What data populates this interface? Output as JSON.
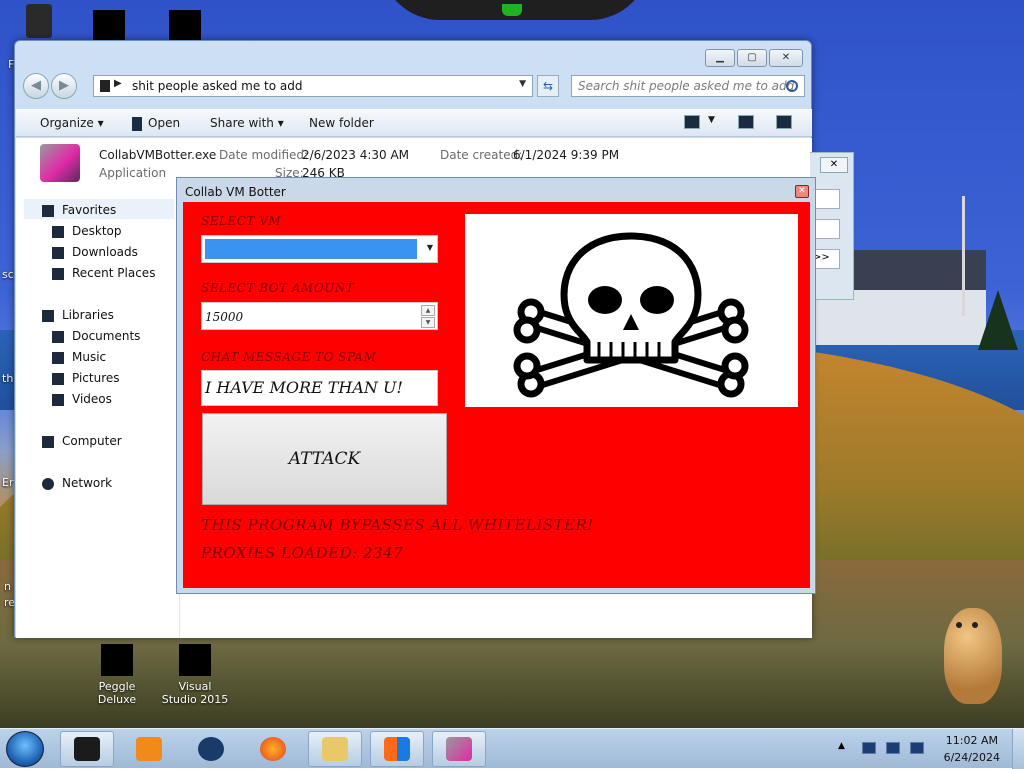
{
  "desktop": {
    "icons_bottom": [
      {
        "label": "Peggle Deluxe"
      },
      {
        "label": "Visual Studio 2015"
      }
    ],
    "edge_fragments": [
      "F",
      "sc",
      "th",
      "Er",
      "n",
      "re"
    ]
  },
  "explorer": {
    "address": "shit people asked me to add",
    "search_placeholder": "Search shit people asked me to add",
    "toolbar": {
      "organize": "Organize",
      "open": "Open",
      "share_with": "Share with",
      "new_folder": "New folder"
    },
    "details": {
      "file_name": "CollabVMBotter.exe",
      "file_type": "Application",
      "modified_label": "Date modified:",
      "modified_value": "2/6/2023 4:30 AM",
      "created_label": "Date created:",
      "created_value": "6/1/2024 9:39 PM",
      "size_label": "Size:",
      "size_value": "246 KB"
    },
    "nav": {
      "favorites": "Favorites",
      "desktop": "Desktop",
      "downloads": "Downloads",
      "recent_places": "Recent Places",
      "libraries": "Libraries",
      "documents": "Documents",
      "music": "Music",
      "pictures": "Pictures",
      "videos": "Videos",
      "computer": "Computer",
      "network": "Network"
    }
  },
  "behind_dialog": {
    "button_label": ">>"
  },
  "botter": {
    "title": "Collab VM Botter",
    "select_vm_label": "SELECT VM",
    "select_bot_amount_label": "SELECT BOT AMOUNT",
    "bot_amount_value": "15000",
    "chat_message_label": "CHAT MESSAGE TO SPAM",
    "chat_message_value": "I HAVE MORE THAN U!",
    "attack_label": "ATTACK",
    "bypass_text": "THIS PROGRAM BYPASSES ALL WHITELISTER!",
    "proxies_text": "PROXIES LOADED: 2347",
    "accent_color": "#ff0000"
  },
  "taskbar": {
    "time": "11:02 AM",
    "date": "6/24/2024"
  }
}
